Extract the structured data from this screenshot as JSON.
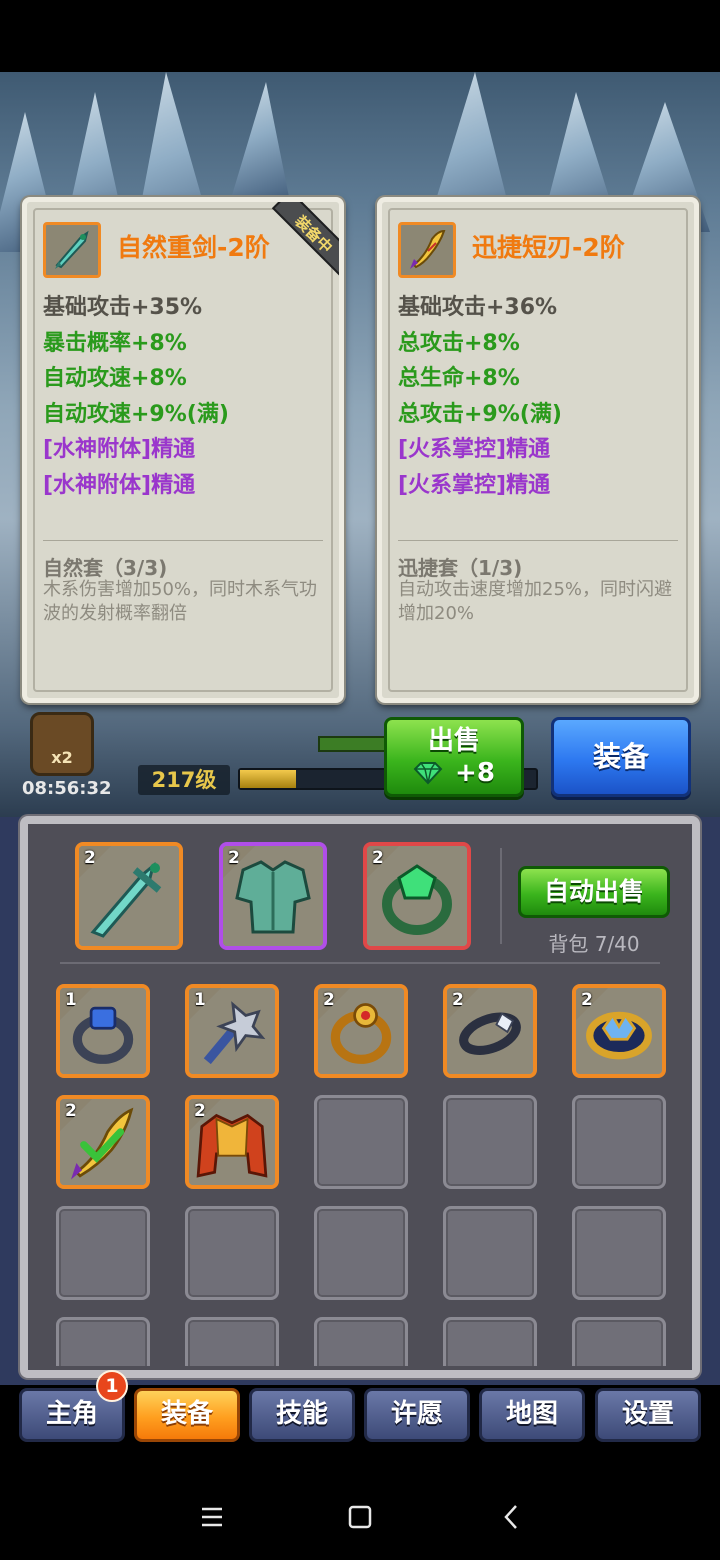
{
  "cards": [
    {
      "title": "自然重剑-2阶",
      "equipped_badge": "装备中",
      "stats": [
        {
          "text": "基础攻击+35%",
          "tier": "base"
        },
        {
          "text": "暴击概率+8%",
          "tier": "green"
        },
        {
          "text": "自动攻速+8%",
          "tier": "green"
        },
        {
          "text": "自动攻速+9%(满)",
          "tier": "green"
        },
        {
          "text": "[水神附体]精通",
          "tier": "purple"
        },
        {
          "text": "[水神附体]精通",
          "tier": "purple"
        }
      ],
      "set_name": "自然套（3/3)",
      "set_desc": "木系伤害增加50%，同时木系气功波的发射概率翻倍",
      "icon": "jade-sword-icon"
    },
    {
      "title": "迅捷短刃-2阶",
      "stats": [
        {
          "text": "基础攻击+36%",
          "tier": "base"
        },
        {
          "text": "总攻击+8%",
          "tier": "green"
        },
        {
          "text": "总生命+8%",
          "tier": "green"
        },
        {
          "text": "总攻击+9%(满)",
          "tier": "green"
        },
        {
          "text": "[火系掌控]精通",
          "tier": "purple"
        },
        {
          "text": "[火系掌控]精通",
          "tier": "purple"
        }
      ],
      "set_name": "迅捷套（1/3)",
      "set_desc": "自动攻击速度增加25%，同时闪避增加20%",
      "icon": "golden-dagger-icon"
    }
  ],
  "hud": {
    "multiplier": "x2",
    "timer": "08:56:32",
    "level": "217级",
    "xp_progress": 0.19
  },
  "actions": {
    "sell_label": "出售",
    "sell_price": "+8",
    "equip_label": "装备",
    "auto_sell_label": "自动出售",
    "bag_count": "背包 7/40"
  },
  "equipped": [
    {
      "level": "2",
      "icon": "jade-sword-icon",
      "rarity_color": "#f08a24"
    },
    {
      "level": "2",
      "icon": "jade-armor-icon",
      "rarity_color": "#b04ee8"
    },
    {
      "level": "2",
      "icon": "emerald-ring-icon",
      "rarity_color": "#e04848"
    }
  ],
  "inventory": [
    {
      "level": "1",
      "icon": "sapphire-ring-icon"
    },
    {
      "level": "1",
      "icon": "spiked-mace-icon"
    },
    {
      "level": "2",
      "icon": "ruby-ring-icon"
    },
    {
      "level": "2",
      "icon": "silver-ring-icon"
    },
    {
      "level": "2",
      "icon": "crown-ring-icon"
    },
    {
      "level": "2",
      "icon": "golden-dagger-icon"
    },
    {
      "level": "2",
      "icon": "flame-armor-icon"
    }
  ],
  "tabs": [
    {
      "label": "主角",
      "active": false,
      "badge": "1"
    },
    {
      "label": "装备",
      "active": true
    },
    {
      "label": "技能",
      "active": false
    },
    {
      "label": "许愿",
      "active": false
    },
    {
      "label": "地图",
      "active": false
    },
    {
      "label": "设置",
      "active": false
    }
  ],
  "system_nav": [
    "menu-icon",
    "home-icon",
    "back-icon"
  ]
}
